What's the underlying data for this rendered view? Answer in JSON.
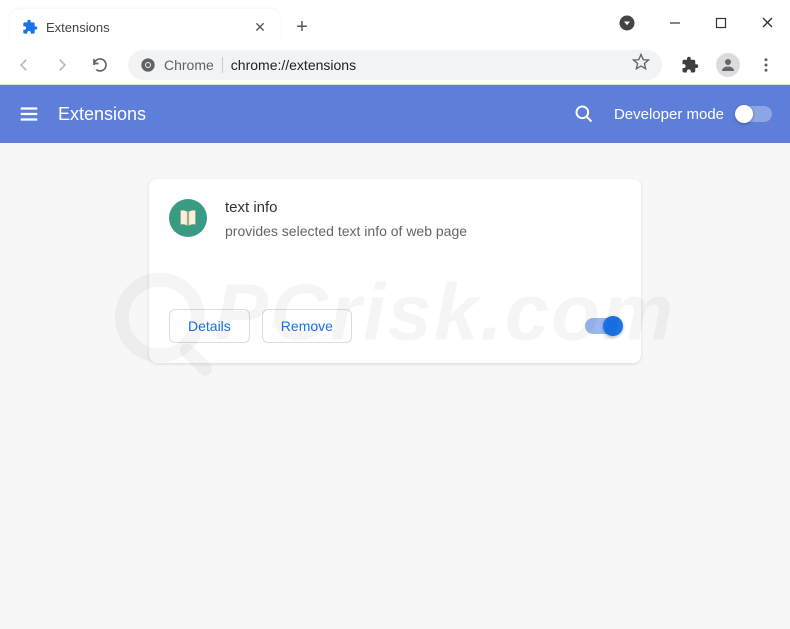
{
  "window": {
    "tab_title": "Extensions"
  },
  "omnibox": {
    "label": "Chrome",
    "url": "chrome://extensions"
  },
  "header": {
    "title": "Extensions",
    "dev_mode_label": "Developer mode"
  },
  "extension": {
    "name": "text info",
    "description": "provides selected text info of web page",
    "details_label": "Details",
    "remove_label": "Remove"
  },
  "watermark": {
    "text": "PCrisk.com"
  }
}
